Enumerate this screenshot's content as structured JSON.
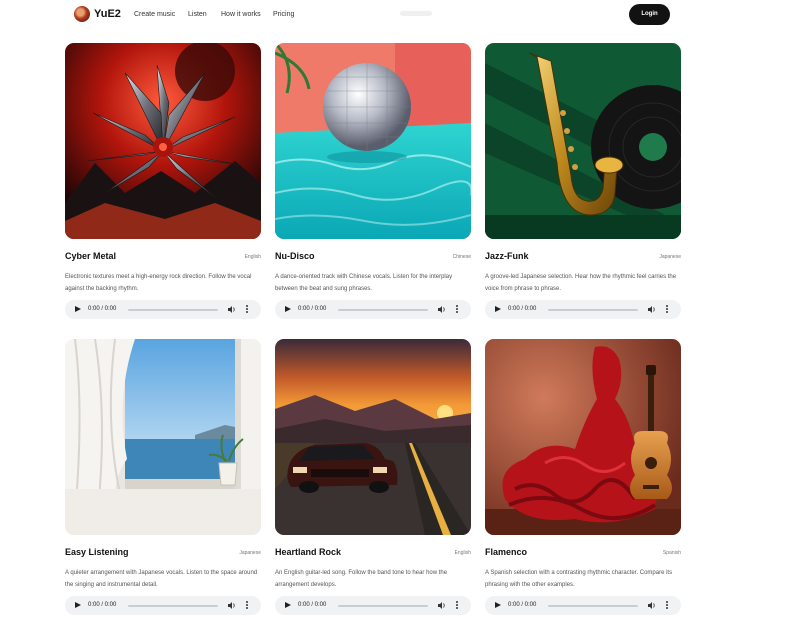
{
  "header": {
    "brand": "YuE2",
    "nav": [
      "Create music",
      "Listen",
      "How it works",
      "Pricing"
    ],
    "login_label": "Login"
  },
  "cards": [
    {
      "title": "Cyber Metal",
      "language": "English",
      "description": "Electronic textures meet a high-energy rock direction. Follow the vocal against the backing rhythm.",
      "time": "0:00 / 0:00"
    },
    {
      "title": "Nu-Disco",
      "language": "Chinese",
      "description": "A dance-oriented track with Chinese vocals. Listen for the interplay between the beat and sung phrases.",
      "time": "0:00 / 0:00"
    },
    {
      "title": "Jazz-Funk",
      "language": "Japanese",
      "description": "A groove-led Japanese selection. Hear how the rhythmic feel carries the voice from phrase to phrase.",
      "time": "0:00 / 0:00"
    },
    {
      "title": "Easy Listening",
      "language": "Japanese",
      "description": "A quieter arrangement with Japanese vocals. Listen to the space around the singing and instrumental detail.",
      "time": "0:00 / 0:00"
    },
    {
      "title": "Heartland Rock",
      "language": "English",
      "description": "An English guitar-led song. Follow the band tone to hear how the arrangement develops.",
      "time": "0:00 / 0:00"
    },
    {
      "title": "Flamenco",
      "language": "Spanish",
      "description": "A Spanish selection with a contrasting rhythmic character. Compare its phrasing with the other examples.",
      "time": "0:00 / 0:00"
    }
  ],
  "icons": {
    "logo": "avatar-logo-icon",
    "play": "play-icon",
    "volume": "volume-icon",
    "more": "more-vertical-icon"
  },
  "colors": {
    "login_bg": "#121212",
    "player_bg": "#f1f2f4"
  }
}
